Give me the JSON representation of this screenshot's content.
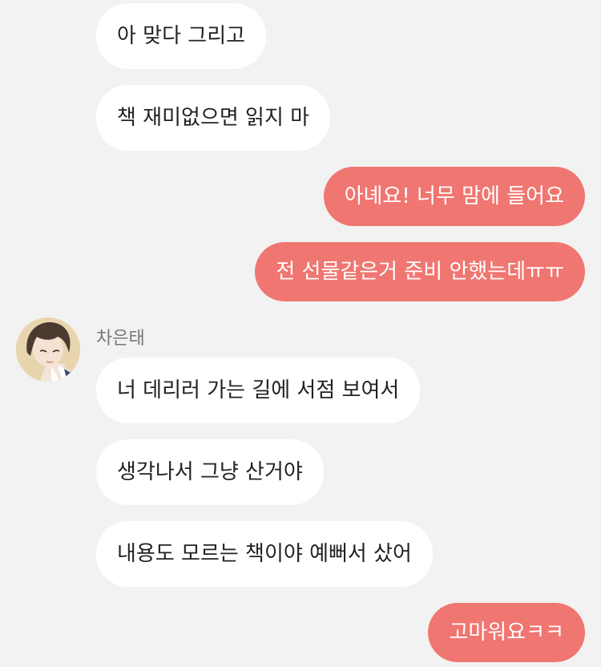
{
  "conversation": {
    "messages": [
      {
        "sender": "them",
        "text": "아 맞다 그리고"
      },
      {
        "sender": "them",
        "text": "책 재미없으면 읽지 마"
      },
      {
        "sender": "me",
        "text": "아녜요! 너무 맘에 들어요"
      },
      {
        "sender": "me",
        "text": "전 선물같은거 준비 안했는데ㅠㅠ"
      },
      {
        "sender": "them",
        "text": "너 데리러 가는 길에 서점 보여서"
      },
      {
        "sender": "them",
        "text": "생각나서 그냥 산거야"
      },
      {
        "sender": "them",
        "text": "내용도 모르는 책이야 예뻐서 샀어"
      },
      {
        "sender": "me",
        "text": "고마워요ㅋㅋ"
      }
    ],
    "contact": {
      "name": "차은태",
      "avatar_icon": "profile-avatar-icon"
    }
  },
  "colors": {
    "background": "#f2f2f2",
    "incoming_bubble": "#ffffff",
    "outgoing_bubble": "#f07671",
    "incoming_text": "#222222",
    "outgoing_text": "#ffffff",
    "sender_name": "#777777"
  }
}
